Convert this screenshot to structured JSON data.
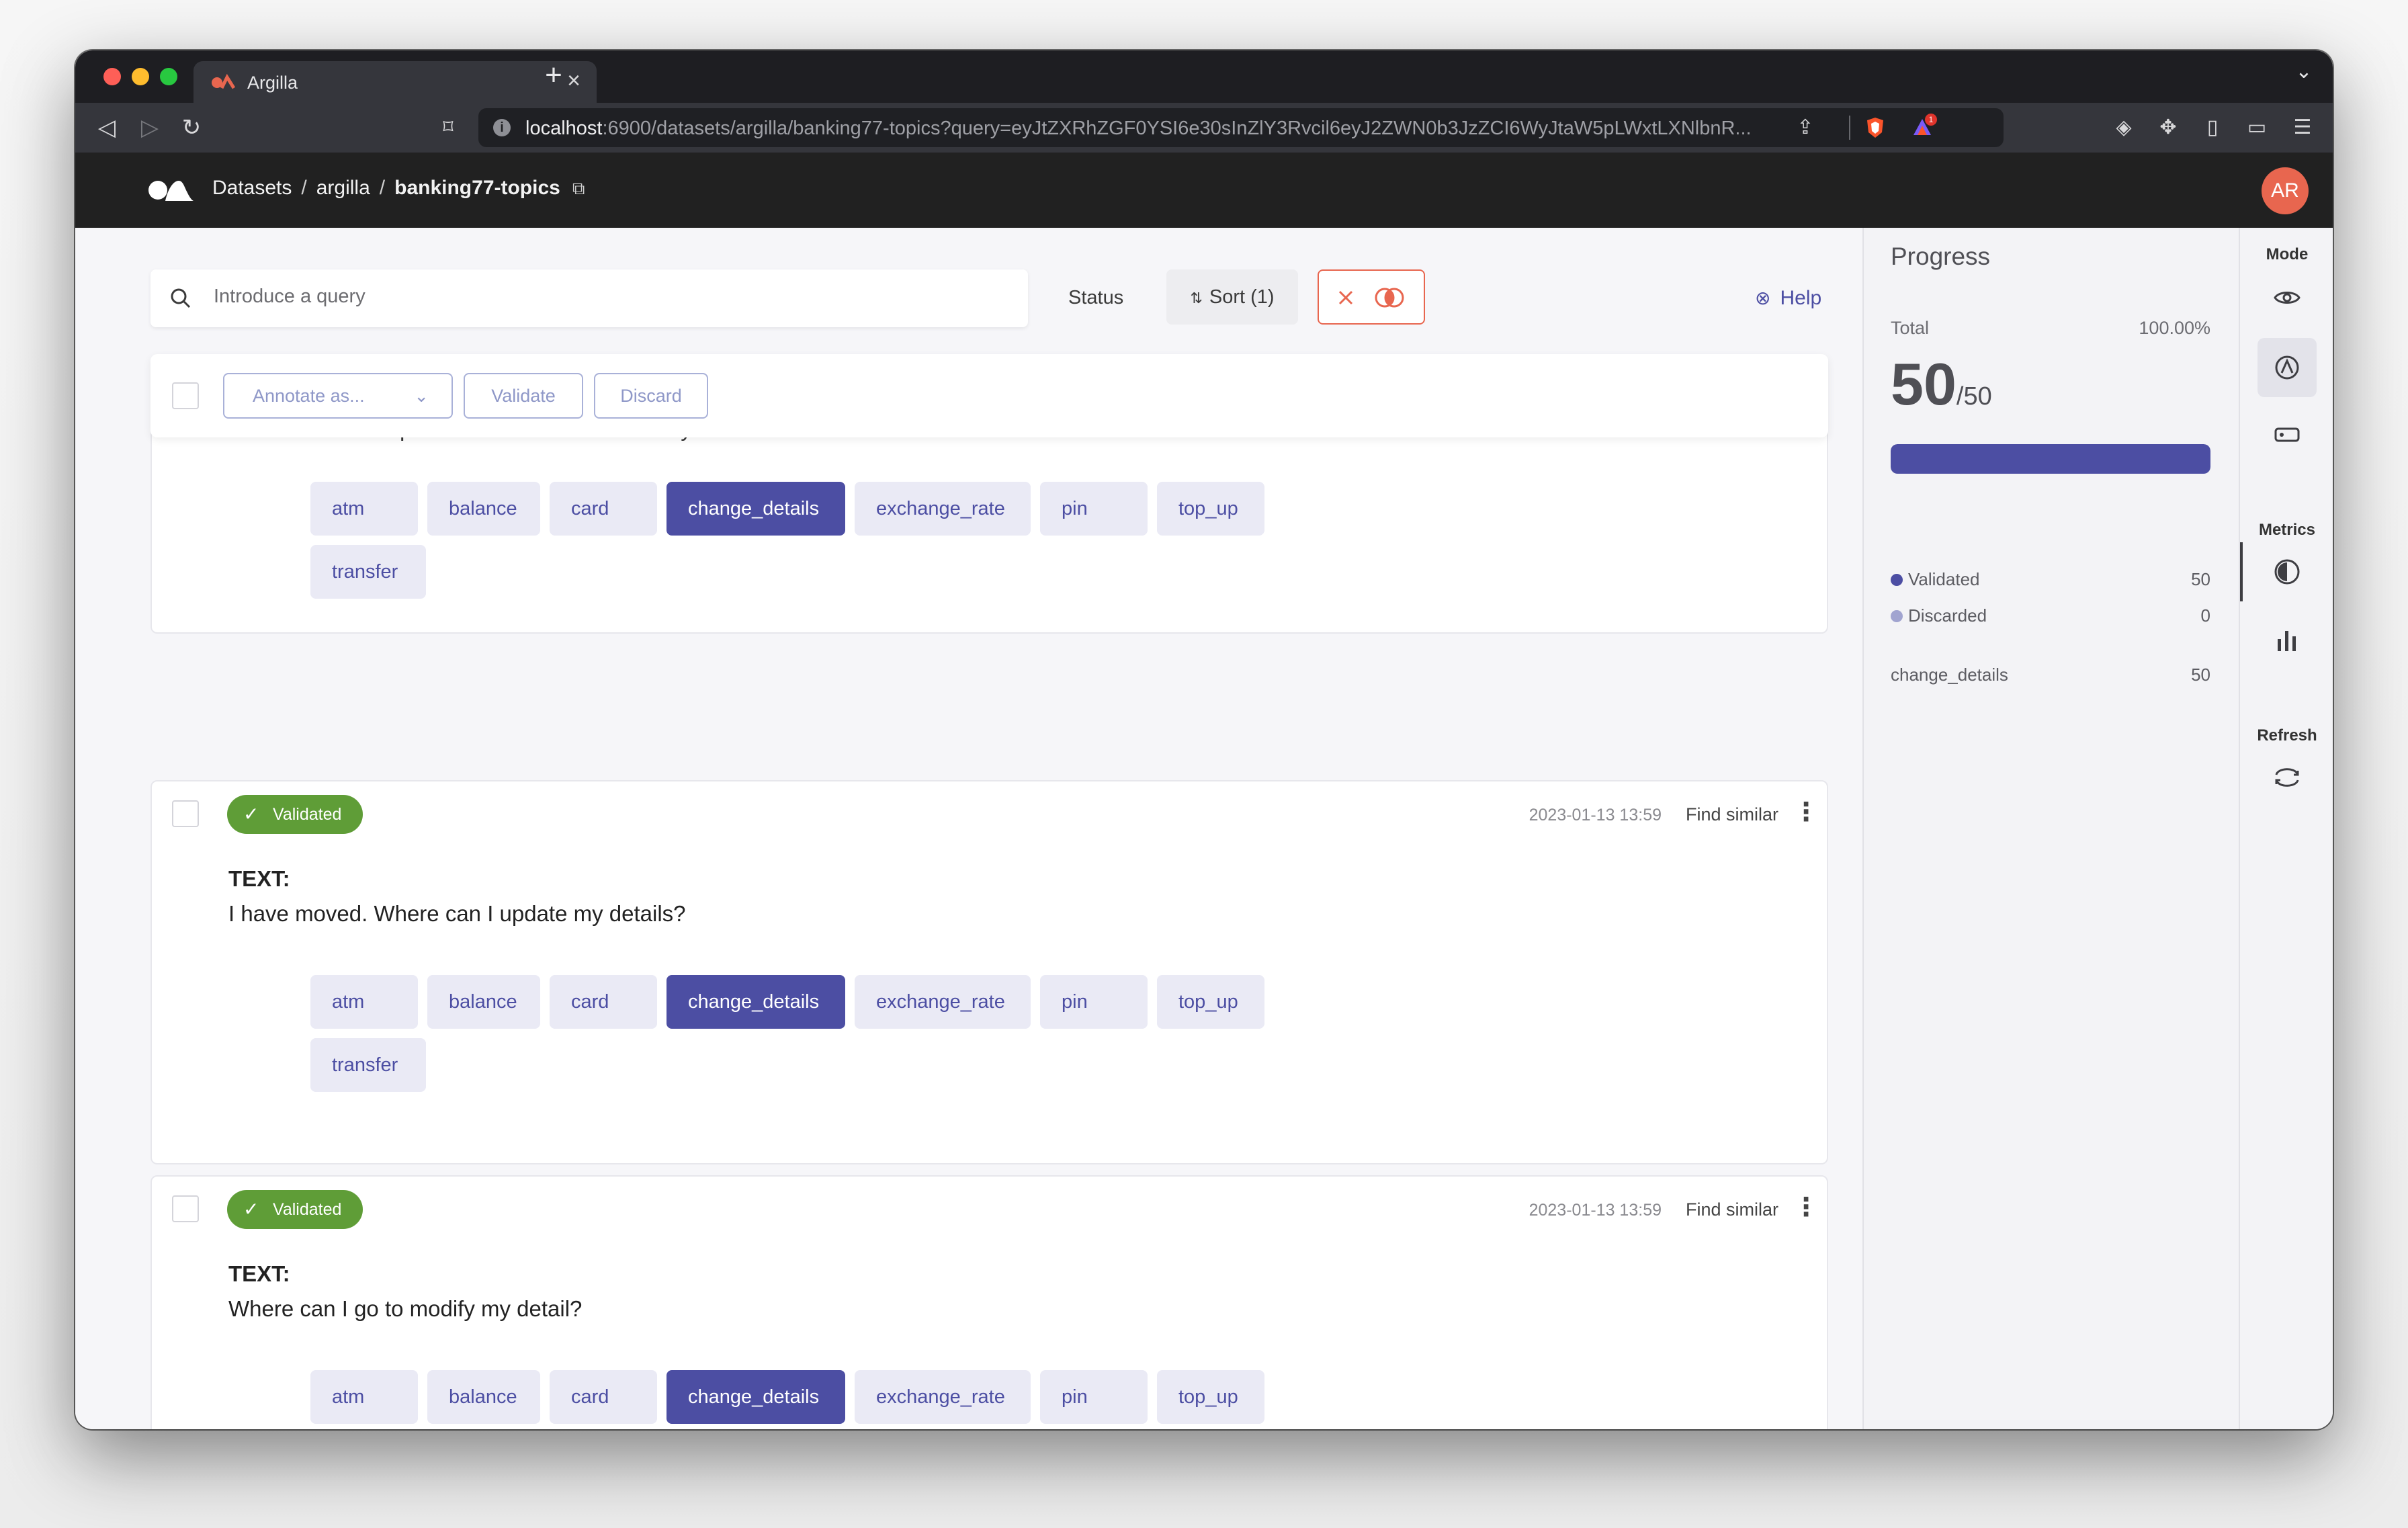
{
  "browser": {
    "tab_title": "Argilla",
    "url_host": "localhost",
    "url_rest": ":6900/datasets/argilla/banking77-topics?query=eyJtZXRhZGF0YSI6e30sInZlY3Rvcil6eyJ2ZWN0b3JzZCI6WyJtaW5pLWxtLXNlbnR...",
    "extension_badge": "1"
  },
  "header": {
    "breadcrumbs": [
      "Datasets",
      "argilla",
      "banking77-topics"
    ],
    "separator": "/",
    "avatar_initials": "AR"
  },
  "toolbar": {
    "search_placeholder": "Introduce a query",
    "status_label": "Status",
    "sort_label": "Sort (1)",
    "help_label": "Help"
  },
  "bulk_actions": {
    "annotate_label": "Annotate as...",
    "validate_label": "Validate",
    "discard_label": "Discard"
  },
  "labels": [
    "atm",
    "balance",
    "card",
    "change_details",
    "exchange_rate",
    "pin",
    "top_up",
    "transfer"
  ],
  "records": [
    {
      "partial_text": "I need to edit the personal details section of my account",
      "selected_label": "change_details"
    },
    {
      "status": "Validated",
      "timestamp": "2023-01-13 13:59",
      "find_similar": "Find similar",
      "field_name": "TEXT:",
      "text": "I have moved. Where can I update my details?",
      "selected_label": "change_details"
    },
    {
      "status": "Validated",
      "timestamp": "2023-01-13 13:59",
      "find_similar": "Find similar",
      "field_name": "TEXT:",
      "text": "Where can I go to modify my detail?",
      "selected_label": "change_details"
    }
  ],
  "progress": {
    "title": "Progress",
    "total_label": "Total",
    "percent": "100.00%",
    "count": "50",
    "total": "/50",
    "fraction": 1.0,
    "validated_label": "Validated",
    "validated_count": "50",
    "discarded_label": "Discarded",
    "discarded_count": "0",
    "label_name": "change_details",
    "label_count": "50"
  },
  "sidenav": {
    "mode_label": "Mode",
    "metrics_label": "Metrics",
    "refresh_label": "Refresh"
  },
  "colors": {
    "accent": "#4c4ea3",
    "validated": "#5f9d37",
    "discarded": "#a1a4d0",
    "danger": "#e8664f",
    "header_bg": "#212121"
  }
}
